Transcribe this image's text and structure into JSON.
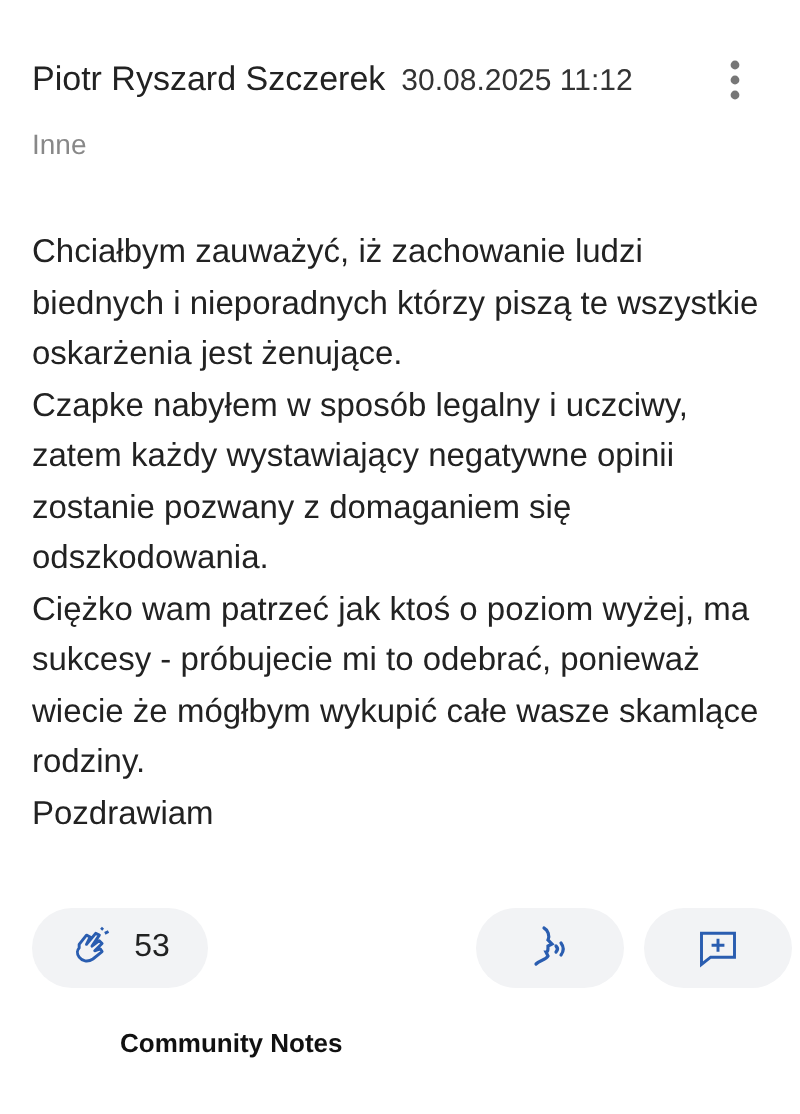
{
  "post": {
    "author": "Piotr Ryszard Szczerek",
    "date": "30.08.2025 11:12",
    "category": "Inne",
    "paragraphs": [
      "Chciałbym zauważyć, iż zachowanie ludzi biednych i nieporadnych którzy piszą te wszystkie oskarżenia jest żenujące.",
      "Czapke nabyłem w sposób legalny i uczciwy, zatem każdy wystawiający negatywne opinii zostanie pozwany z domaganiem się odszkodowania.",
      "Ciężko wam patrzeć jak ktoś o poziom wyżej, ma sukcesy - próbujecie mi to odebrać, ponieważ wiecie że mógłbym wykupić całe wasze skamlące rodziny.",
      "Pozdrawiam"
    ],
    "likes": "53"
  },
  "section_title": "Community Notes"
}
